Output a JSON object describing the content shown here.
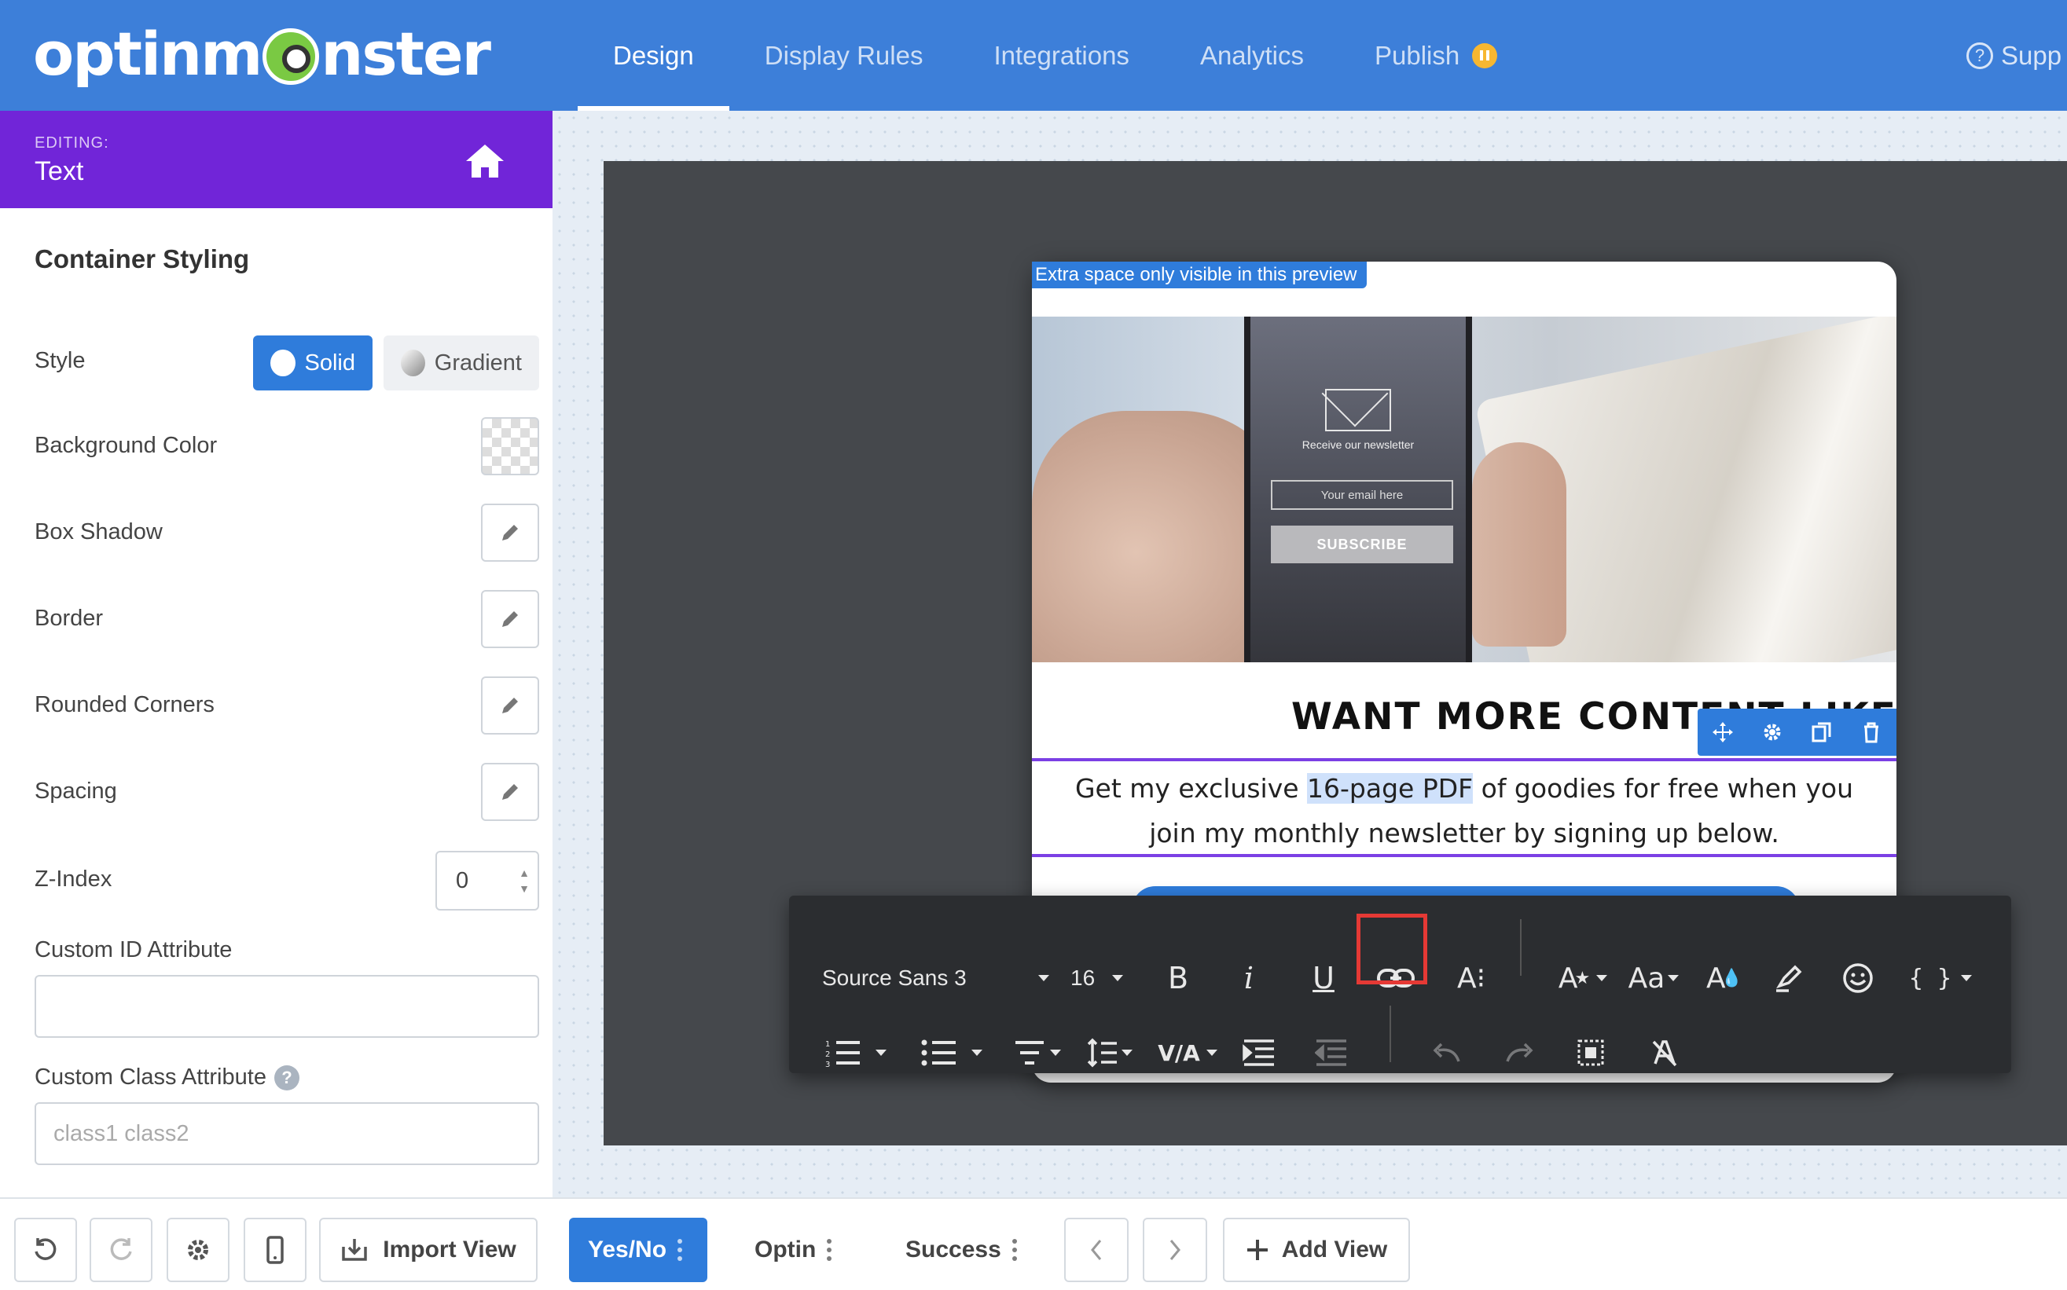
{
  "app": {
    "logo": "optinmonster"
  },
  "nav": {
    "tabs": [
      "Design",
      "Display Rules",
      "Integrations",
      "Analytics",
      "Publish"
    ],
    "active": "Design",
    "support": "Supp"
  },
  "sidebar": {
    "editing_label": "EDITING:",
    "editing_value": "Text",
    "section_title": "Container Styling",
    "style_label": "Style",
    "style_options": [
      "Solid",
      "Gradient"
    ],
    "style_selected": "Solid",
    "rows": [
      "Background Color",
      "Box Shadow",
      "Border",
      "Rounded Corners",
      "Spacing"
    ],
    "zindex_label": "Z-Index",
    "zindex_value": "0",
    "custom_id_label": "Custom ID Attribute",
    "custom_id_value": "",
    "custom_class_label": "Custom Class Attribute",
    "custom_class_placeholder": "class1 class2"
  },
  "bottombar": {
    "import_view": "Import View",
    "views": [
      "Yes/No",
      "Optin",
      "Success"
    ],
    "active_view": "Yes/No",
    "add_view": "Add View"
  },
  "preview": {
    "extra_space_note": "Extra space only visible in this preview",
    "phone_caption": "Receive our newsletter",
    "phone_email_placeholder": "Your email here",
    "phone_button": "SUBSCRIBE",
    "headline": "WANT MORE CONTENT LIKE T",
    "body_before": "Get my exclusive ",
    "body_highlight": "16-page PDF",
    "body_after": " of goodies for free when you",
    "body_line2": "join my monthly newsletter by signing up below."
  },
  "rte": {
    "font": "Source Sans 3",
    "size": "16",
    "letter_spacing_label": "V/A",
    "case_label": "Aa",
    "braces_label": "{ }",
    "bold_label": "B",
    "italic_label": "i",
    "underline_label": "U"
  },
  "colors": {
    "topbar": "#3d7fd9",
    "editing_header": "#7125d8",
    "accent": "#2f7cdb",
    "publish_badge": "#f7b731",
    "highlight_box": "#e53935"
  }
}
